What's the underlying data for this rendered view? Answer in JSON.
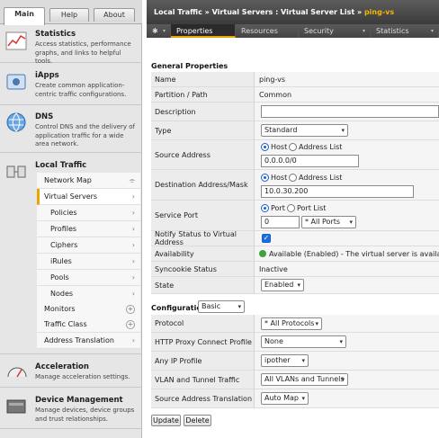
{
  "sidebar": {
    "tabs": {
      "main": "Main",
      "help": "Help",
      "about": "About"
    },
    "sections": {
      "statistics": {
        "title": "Statistics",
        "desc": "Access statistics, performance graphs, and links to helpful tools."
      },
      "iapps": {
        "title": "iApps",
        "desc": "Create common application-centric traffic configurations."
      },
      "dns": {
        "title": "DNS",
        "desc": "Control DNS and the delivery of application traffic for a wide area network."
      },
      "local_traffic": {
        "title": "Local Traffic"
      },
      "acceleration": {
        "title": "Acceleration",
        "desc": "Manage acceleration settings."
      },
      "device_mgmt": {
        "title": "Device Management",
        "desc": "Manage devices, device groups and trust relationships."
      }
    },
    "nav": {
      "network_map": "Network Map",
      "virtual_servers": "Virtual Servers",
      "policies": "Policies",
      "profiles": "Profiles",
      "ciphers": "Ciphers",
      "irules": "iRules",
      "pools": "Pools",
      "nodes": "Nodes",
      "monitors": "Monitors",
      "traffic_class": "Traffic Class",
      "address_translation": "Address Translation"
    }
  },
  "header": {
    "crumb1": "Local Traffic",
    "sep": "»",
    "crumb2": "Virtual Servers : Virtual Server List",
    "current": "ping-vs"
  },
  "tabs": {
    "gear": "✱",
    "properties": "Properties",
    "resources": "Resources",
    "security": "Security",
    "statistics": "Statistics"
  },
  "general": {
    "heading": "General Properties",
    "name_label": "Name",
    "name_value": "ping-vs",
    "partition_label": "Partition / Path",
    "partition_value": "Common",
    "description_label": "Description",
    "description_value": "",
    "type_label": "Type",
    "type_value": "Standard",
    "source_label": "Source Address",
    "source_host": "Host",
    "source_list": "Address List",
    "source_value": "0.0.0.0/0",
    "dest_label": "Destination Address/Mask",
    "dest_host": "Host",
    "dest_list": "Address List",
    "dest_value": "10.0.30.200",
    "port_label": "Service Port",
    "port_port": "Port",
    "port_list": "Port List",
    "port_value": "0",
    "port_select": "* All Ports",
    "notify_label": "Notify Status to Virtual Address",
    "avail_label": "Availability",
    "avail_value": "Available (Enabled) - The virtual server is available",
    "syncookie_label": "Syncookie Status",
    "syncookie_value": "Inactive",
    "state_label": "State",
    "state_value": "Enabled"
  },
  "config": {
    "heading": "Configuration:",
    "mode": "Basic",
    "protocol_label": "Protocol",
    "protocol_value": "* All Protocols",
    "http_label": "HTTP Proxy Connect Profile",
    "http_value": "None",
    "ip_label": "Any IP Profile",
    "ip_value": "ipother",
    "vlan_label": "VLAN and Tunnel Traffic",
    "vlan_value": "All VLANs and Tunnels",
    "snat_label": "Source Address Translation",
    "snat_value": "Auto Map"
  },
  "buttons": {
    "update": "Update",
    "delete": "Delete"
  },
  "colors": {
    "accent": "#e9a600",
    "titlebar": "#3b3b3b",
    "available": "#3fa23f",
    "checkbox": "#1a6fe0"
  }
}
